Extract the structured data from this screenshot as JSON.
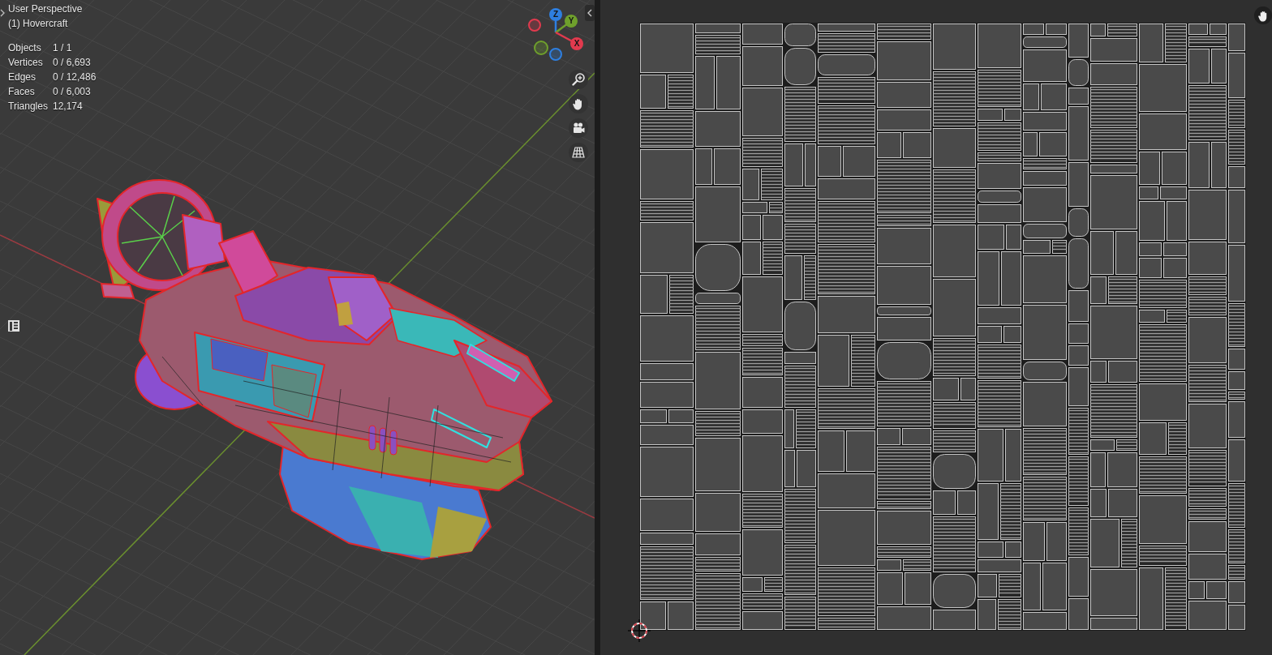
{
  "viewport": {
    "view_name": "User Perspective",
    "object_name": "(1) Hovercraft",
    "stats": [
      {
        "label": "Objects",
        "value": "1 / 1"
      },
      {
        "label": "Vertices",
        "value": "0 / 6,693"
      },
      {
        "label": "Edges",
        "value": "0 / 12,486"
      },
      {
        "label": "Faces",
        "value": "0 / 6,003"
      },
      {
        "label": "Triangles",
        "value": "12,174"
      }
    ],
    "gizmo": {
      "axes": [
        {
          "label": "Z",
          "color": "#2e7fe0"
        },
        {
          "label": "Y",
          "color": "#6fa02c"
        },
        {
          "label": "X",
          "color": "#e23a4e"
        }
      ]
    }
  }
}
